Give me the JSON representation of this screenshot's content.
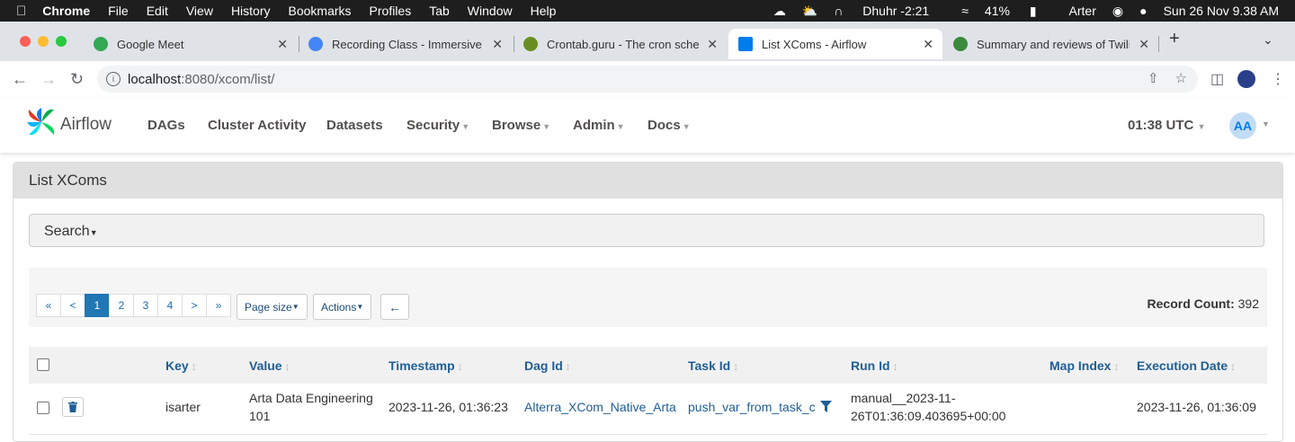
{
  "menubar": {
    "app": "Chrome",
    "items": [
      "File",
      "Edit",
      "View",
      "History",
      "Bookmarks",
      "Profiles",
      "Tab",
      "Window",
      "Help"
    ],
    "prayer": "Dhuhr -2:21",
    "battery": "41%",
    "user": "Arter",
    "datetime": "Sun 26 Nov  9.38 AM"
  },
  "tabs": [
    {
      "title": "Google Meet",
      "color": "#34a853"
    },
    {
      "title": "Recording Class - Immersive D",
      "color": "#4285f4"
    },
    {
      "title": "Crontab.guru - The cron sched",
      "color": "#6b8e23"
    },
    {
      "title": "List XComs - Airflow",
      "color": "#017cee"
    },
    {
      "title": "Summary and reviews of Twilig",
      "color": "#3c8a3c"
    }
  ],
  "address": {
    "host": "localhost",
    "path": ":8080/xcom/list/"
  },
  "navbar": {
    "brand": "Airflow",
    "items": [
      "DAGs",
      "Cluster Activity",
      "Datasets",
      "Security",
      "Browse",
      "Admin",
      "Docs"
    ],
    "time": "01:38 UTC",
    "avatar": "AA"
  },
  "panel": {
    "title": "List XComs",
    "search_label": "Search",
    "pager": [
      "«",
      "<",
      "1",
      "2",
      "3",
      "4",
      ">",
      "»"
    ],
    "page_size_label": "Page size",
    "actions_label": "Actions",
    "back_glyph": "←",
    "record_count_label": "Record Count:",
    "record_count": "392",
    "columns": [
      "Key",
      "Value",
      "Timestamp",
      "Dag Id",
      "Task Id",
      "Run Id",
      "Map Index",
      "Execution Date"
    ],
    "rows": [
      {
        "key": "isarter",
        "value_line1": "Arta Data Engineering",
        "value_line2": "101",
        "timestamp": "2023-11-26, 01:36:23",
        "dag_id": "Alterra_XCom_Native_Arta",
        "task_id": "push_var_from_task_c",
        "run_id_line1": "manual__2023-11-",
        "run_id_line2": "26T01:36:09.403695+00:00",
        "map_index": "",
        "execution_date": "2023-11-26, 01:36:09"
      }
    ]
  }
}
